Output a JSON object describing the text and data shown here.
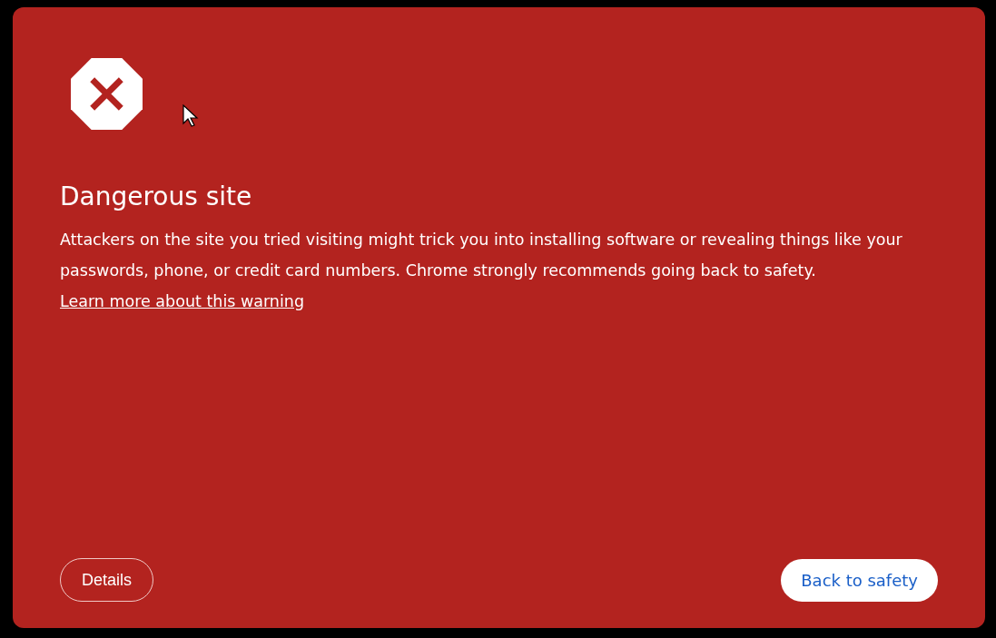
{
  "heading": "Dangerous site",
  "message": {
    "text": "Attackers on the site you tried visiting might trick you into installing software or revealing things like your passwords, phone, or credit card numbers. Chrome strongly recommends going back to safety.",
    "link": "Learn more about this warning"
  },
  "buttons": [
    {
      "label": "Details",
      "kind": "secondary"
    },
    {
      "label": "Back to safety",
      "kind": "primary"
    }
  ]
}
